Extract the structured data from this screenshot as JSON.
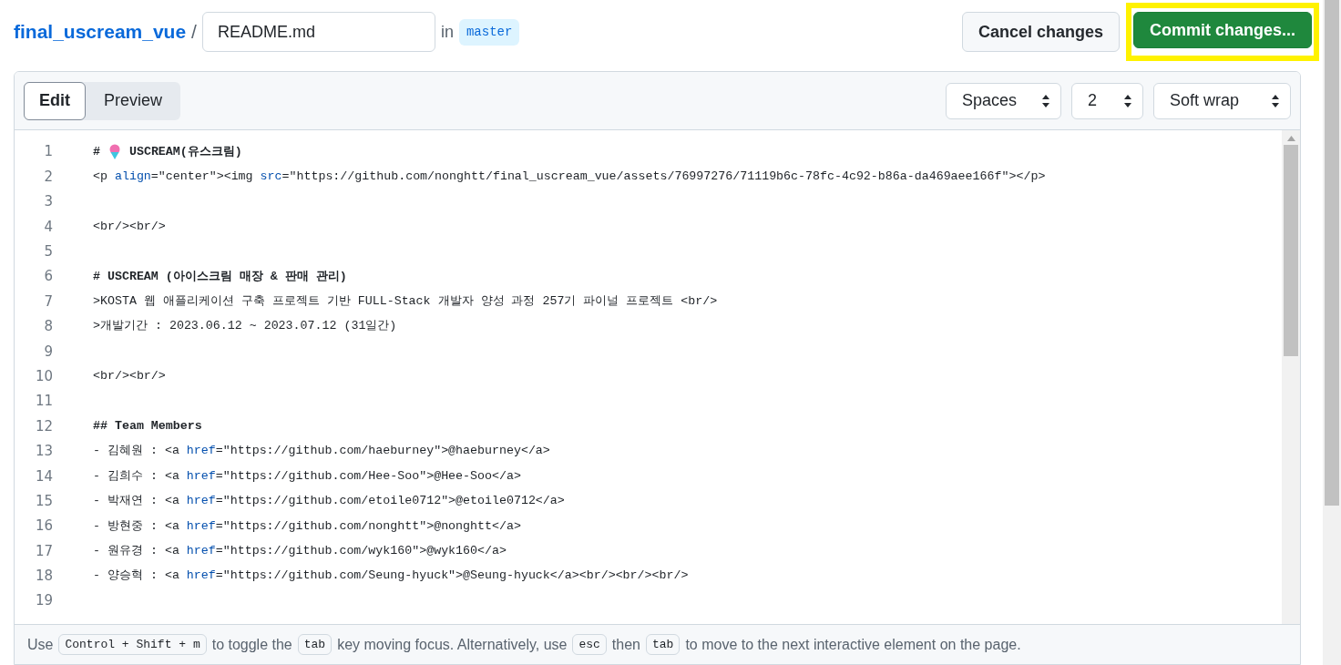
{
  "breadcrumb": {
    "repo": "final_uscream_vue",
    "separator": "/",
    "filename": "README.md",
    "in_label": "in",
    "branch": "master"
  },
  "actions": [
    {
      "label": "Cancel changes",
      "kind": "secondary",
      "highlighted": false
    },
    {
      "label": "Commit changes...",
      "kind": "primary",
      "highlighted": true
    }
  ],
  "tabs": [
    {
      "label": "Edit",
      "selected": true
    },
    {
      "label": "Preview",
      "selected": false
    }
  ],
  "selects": [
    {
      "value": "Spaces"
    },
    {
      "value": "2"
    },
    {
      "value": "Soft wrap"
    }
  ],
  "code_lines": [
    {
      "number": "1",
      "bold": true,
      "tokens": [
        {
          "kind": "text",
          "text": "# "
        },
        {
          "kind": "icon"
        },
        {
          "kind": "text",
          "text": " USCREAM(유스크림)"
        }
      ]
    },
    {
      "number": "2",
      "bold": false,
      "tokens": [
        {
          "kind": "text",
          "text": "<p "
        },
        {
          "kind": "attr",
          "text": "align"
        },
        {
          "kind": "text",
          "text": "=\"center\"><img "
        },
        {
          "kind": "attr",
          "text": "src"
        },
        {
          "kind": "text",
          "text": "=\"https://github.com/nonghtt/final_uscream_vue/assets/76997276/71119b6c-78fc-4c92-b86a-da469aee166f\"></p>"
        }
      ]
    },
    {
      "number": "3"
    },
    {
      "number": "4",
      "bold": false,
      "tokens": [
        {
          "kind": "text",
          "text": "<br/><br/>"
        }
      ]
    },
    {
      "number": "5"
    },
    {
      "number": "6",
      "bold": true,
      "tokens": [
        {
          "kind": "text",
          "text": "# USCREAM (아이스크림 매장 & 판매 관리)"
        }
      ]
    },
    {
      "number": "7",
      "bold": false,
      "tokens": [
        {
          "kind": "text",
          "text": ">KOSTA 웹 애플리케이션 구축 프로젝트 기반 FULL-Stack 개발자 양성 과정 257기 파이널 프로젝트 <br/>"
        }
      ]
    },
    {
      "number": "8",
      "bold": false,
      "tokens": [
        {
          "kind": "text",
          "text": ">개발기간 : 2023.06.12 ~ 2023.07.12 (31일간)"
        }
      ]
    },
    {
      "number": "9"
    },
    {
      "number": "10",
      "bold": false,
      "tokens": [
        {
          "kind": "text",
          "text": "<br/><br/>"
        }
      ]
    },
    {
      "number": "11"
    },
    {
      "number": "12",
      "bold": true,
      "tokens": [
        {
          "kind": "text",
          "text": "## Team Members"
        }
      ]
    },
    {
      "number": "13",
      "bold": false,
      "tokens": [
        {
          "kind": "text",
          "text": "- 김혜원 : <a "
        },
        {
          "kind": "attr",
          "text": "href"
        },
        {
          "kind": "text",
          "text": "=\"https://github.com/haeburney\">@haeburney</a>"
        }
      ]
    },
    {
      "number": "14",
      "bold": false,
      "tokens": [
        {
          "kind": "text",
          "text": "- 김희수 : <a "
        },
        {
          "kind": "attr",
          "text": "href"
        },
        {
          "kind": "text",
          "text": "=\"https://github.com/Hee-Soo\">@Hee-Soo</a>"
        }
      ]
    },
    {
      "number": "15",
      "bold": false,
      "tokens": [
        {
          "kind": "text",
          "text": "- 박재연 : <a "
        },
        {
          "kind": "attr",
          "text": "href"
        },
        {
          "kind": "text",
          "text": "=\"https://github.com/etoile0712\">@etoile0712</a>"
        }
      ]
    },
    {
      "number": "16",
      "bold": false,
      "tokens": [
        {
          "kind": "text",
          "text": "- 방현중 : <a "
        },
        {
          "kind": "attr",
          "text": "href"
        },
        {
          "kind": "text",
          "text": "=\"https://github.com/nonghtt\">@nonghtt</a>"
        }
      ]
    },
    {
      "number": "17",
      "bold": false,
      "tokens": [
        {
          "kind": "text",
          "text": "- 원유경 : <a "
        },
        {
          "kind": "attr",
          "text": "href"
        },
        {
          "kind": "text",
          "text": "=\"https://github.com/wyk160\">@wyk160</a>"
        }
      ]
    },
    {
      "number": "18",
      "bold": false,
      "tokens": [
        {
          "kind": "text",
          "text": "- 양승혁 : <a "
        },
        {
          "kind": "attr",
          "text": "href"
        },
        {
          "kind": "text",
          "text": "=\"https://github.com/Seung-hyuck\">@Seung-hyuck</a><br/><br/><br/>"
        }
      ]
    },
    {
      "number": "19"
    }
  ],
  "footer_hint": [
    {
      "text": "Use",
      "kbd": false
    },
    {
      "text": "Control + Shift + m",
      "kbd": true
    },
    {
      "text": "to toggle the",
      "kbd": false
    },
    {
      "text": "tab",
      "kbd": true
    },
    {
      "text": "key moving focus. Alternatively, use",
      "kbd": false
    },
    {
      "text": "esc",
      "kbd": true
    },
    {
      "text": "then",
      "kbd": false
    },
    {
      "text": "tab",
      "kbd": true
    },
    {
      "text": "to move to the next interactive element on the page.",
      "kbd": false
    }
  ]
}
